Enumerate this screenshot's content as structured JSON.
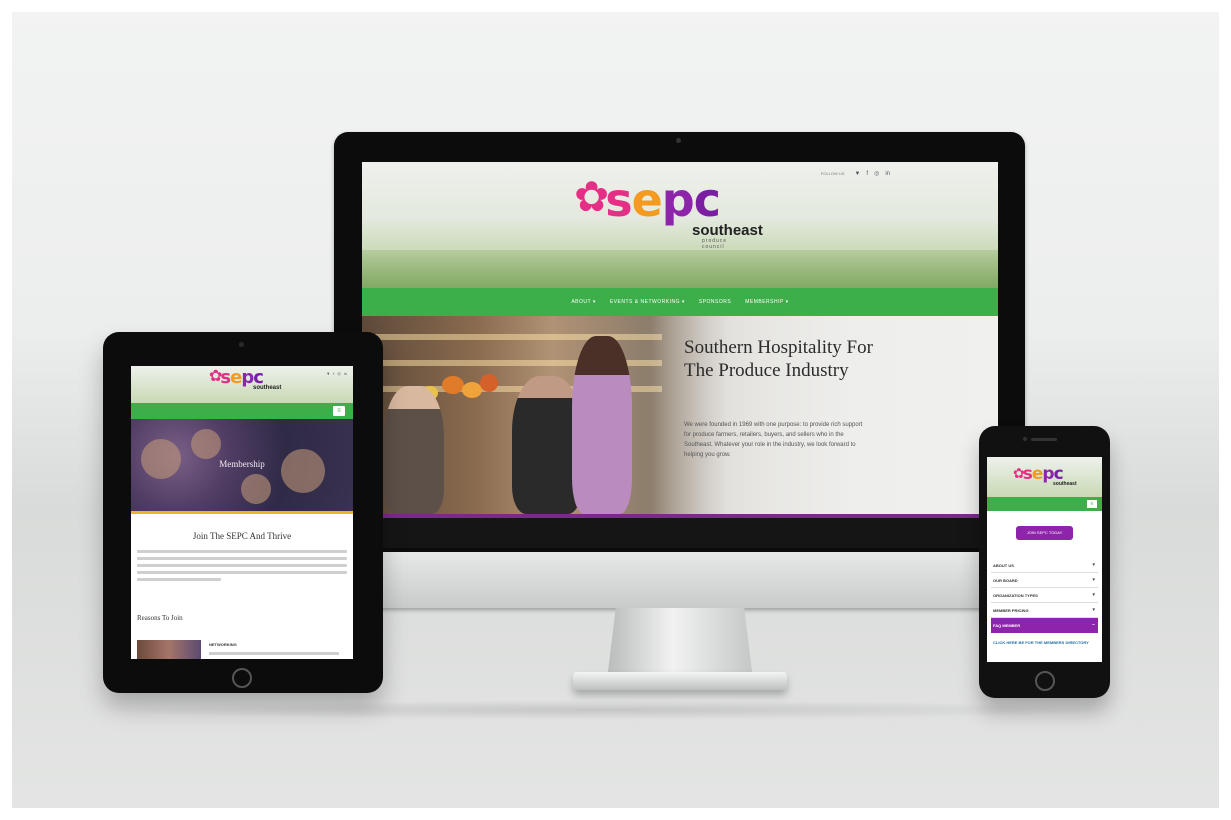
{
  "colors": {
    "brand_green": "#3cae4a",
    "brand_purple": "#8e24aa",
    "brand_pink": "#e52f86",
    "brand_orange": "#f39a1f",
    "accent_yellow": "#f0b323"
  },
  "logo": {
    "word_s": "s",
    "word_e": "e",
    "word_p": "p",
    "word_c": "c",
    "subtitle": "southeast",
    "tagline": "produce council",
    "map_icon": "state-map-leaf-icon"
  },
  "desktop": {
    "social_label": "FOLLOW US",
    "social_icons": [
      "twitter-icon",
      "facebook-icon",
      "instagram-icon",
      "linkedin-icon"
    ],
    "nav": [
      "ABOUT ▾",
      "EVENTS & NETWORKING ▾",
      "SPONSORS",
      "MEMBERSHIP ▾"
    ],
    "hero_title": "Southern Hospitality For The Produce Industry",
    "hero_text": "We were founded in 1969 with one purpose: to provide rich support for produce farmers, retailers, buyers, and sellers who in the Southeast. Whatever your role in the industry, we look forward to helping you grow."
  },
  "tablet": {
    "hero_title": "Membership",
    "section_title": "Join The SEPC And Thrive",
    "subsection_title": "Reasons To Join",
    "item_title": "NETWORKING"
  },
  "phone": {
    "button_label": "JOIN SEPC TODAY",
    "menu_items": [
      "ABOUT US",
      "OUR BOARD",
      "ORGANIZATION TYPES",
      "MEMBER PRICING",
      "FAQ MEMBER"
    ],
    "active_index": 4,
    "link_text": "CLICK HERE BE FOR THE MEMBERS DIRECTORY"
  }
}
